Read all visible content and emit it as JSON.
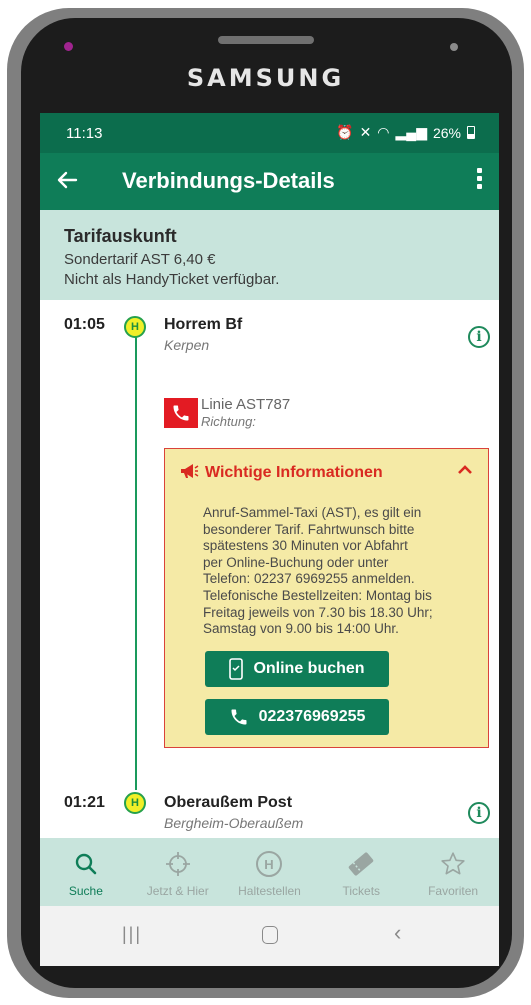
{
  "device": {
    "brand": "SAMSUNG"
  },
  "status": {
    "time": "11:13",
    "battery": "26%"
  },
  "appbar": {
    "title": "Verbindungs-Details"
  },
  "tarif": {
    "title": "Tarifauskunft",
    "price_line": "Sondertarif AST 6,40 €",
    "note": "Nicht als HandyTicket verfügbar."
  },
  "stops": [
    {
      "time": "01:05",
      "icon": "H",
      "name": "Horrem Bf",
      "sub": "Kerpen"
    },
    {
      "time": "01:21",
      "icon": "H",
      "name": "Oberaußem Post",
      "sub": "Bergheim-Oberaußem"
    }
  ],
  "line": {
    "name": "Linie AST787",
    "direction": "Richtung:"
  },
  "info": {
    "title": "Wichtige Informationen",
    "lines": [
      "Anruf-Sammel-Taxi (AST), es gilt ein",
      "besonderer Tarif. Fahrtwunsch bitte",
      "spätestens 30 Minuten vor Abfahrt",
      "per Online-Buchung oder unter",
      "Telefon: 02237 6969255 anmelden.",
      "Telefonische Bestellzeiten: Montag bis",
      "Freitag jeweils von 7.30 bis 18.30 Uhr;",
      "Samstag von 9.00 bis 14:00 Uhr."
    ],
    "online_button": "Online buchen",
    "phone_button": "022376969255"
  },
  "bottomnav": [
    {
      "label": "Suche",
      "icon": "search-icon",
      "active": true
    },
    {
      "label": "Jetzt & Hier",
      "icon": "crosshair-icon",
      "active": false
    },
    {
      "label": "Haltestellen",
      "icon": "stop-icon",
      "active": false
    },
    {
      "label": "Tickets",
      "icon": "ticket-icon",
      "active": false
    },
    {
      "label": "Favoriten",
      "icon": "star-icon",
      "active": false
    }
  ],
  "colors": {
    "primary": "#0f7d58",
    "statusbar": "#0c6d4d",
    "tint": "#c8e4dc",
    "alert": "#d92a21",
    "info_bg": "#f5eaa6"
  }
}
